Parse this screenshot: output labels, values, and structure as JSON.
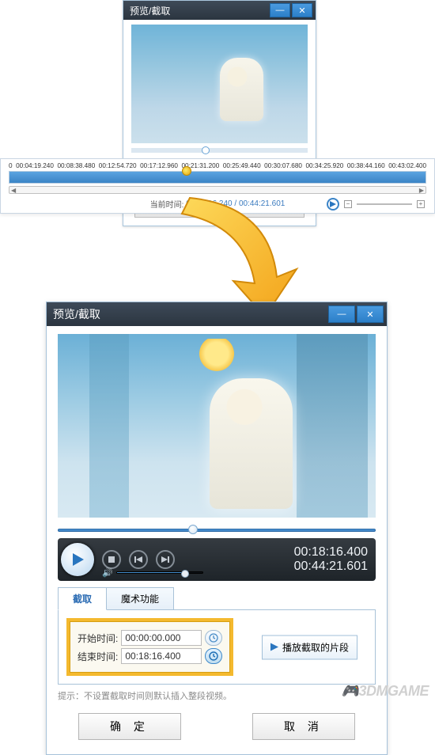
{
  "title": "预览/截取",
  "top_window": {
    "fields": {
      "end_label": "结束时间:",
      "end_value": "00:44:21.601"
    },
    "play_segment": "播放截取的片段",
    "hint": "提示：不设置截取时间则默认插入整段视频。",
    "ok": "确 定",
    "cancel": "取 消"
  },
  "timeline": {
    "ticks": [
      "0",
      "00:04:19.240",
      "00:08:38.480",
      "00:12:54.720",
      "00:17:12.960",
      "00:21:31.200",
      "00:25:49.440",
      "00:30:07.680",
      "00:34:25.920",
      "00:38:44.160",
      "00:43:02.400"
    ],
    "current_label": "当前时间:",
    "current_value": "00:18:16.240 / 00:44:21.601"
  },
  "bottom_window": {
    "transport": {
      "elapsed": "00:18:16.400",
      "total": "00:44:21.601"
    },
    "tabs": {
      "cut": "截取",
      "magic": "魔术功能"
    },
    "form": {
      "start_label": "开始时间:",
      "start_value": "00:00:00.000",
      "end_label": "结束时间:",
      "end_value": "00:18:16.400"
    },
    "play_segment": "播放截取的片段",
    "hint": "提示：不设置截取时间则默认插入整段视频。",
    "ok": "确 定",
    "cancel": "取 消"
  },
  "watermark": "3DMGAME"
}
